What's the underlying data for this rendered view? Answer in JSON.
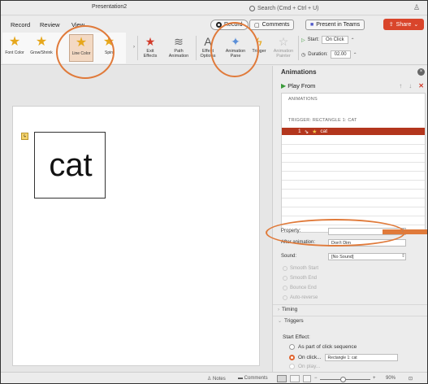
{
  "window": {
    "title": "Presentation2"
  },
  "search": {
    "placeholder": "Search (Cmd + Ctrl + U)"
  },
  "ribbon_tabs": [
    "Record",
    "Review",
    "View"
  ],
  "toolbar": {
    "record_label": "Record",
    "comments_label": "Comments",
    "teams_label": "Present in Teams",
    "share_label": "Share"
  },
  "gallery": {
    "items": [
      "Font Color",
      "Grow/Shrink",
      "Line Color",
      "Spin"
    ],
    "selected": "Line Color"
  },
  "ribbon_buttons": {
    "exit_effects": [
      "Exit",
      "Effects"
    ],
    "path_animation": [
      "Path",
      "Animation"
    ],
    "effect_options": [
      "Effect",
      "Options"
    ],
    "animation_pane": [
      "Animation",
      "Pane"
    ],
    "trigger": "Trigger",
    "animation_painter": [
      "Animation",
      "Painter"
    ]
  },
  "timing": {
    "start_label": "Start:",
    "start_value": "On Click",
    "duration_label": "Duration:",
    "duration_value": "02.00"
  },
  "slide": {
    "shape_text": "cat"
  },
  "pane": {
    "title": "Animations",
    "play_label": "Play From",
    "list_header": "ANIMATIONS",
    "trigger_header": "TRIGGER: RECTANGLE 1: CAT",
    "selected_item": {
      "number": "1",
      "name": "cat"
    },
    "property_label": "Property:",
    "property_color": "#e07a3a",
    "after_label": "After animation:",
    "after_value": "Don't Dim",
    "sound_label": "Sound:",
    "sound_value": "[No Sound]",
    "options": [
      "Smooth Start",
      "Smooth End",
      "Bounce End",
      "Auto-reverse"
    ],
    "timing_section": "Timing",
    "triggers_section": "Triggers",
    "start_effect_label": "Start Effect:",
    "radio_sequence": "As part of click sequence",
    "radio_onclick": "On click...",
    "onclick_value": "Rectangle 1: cat",
    "radio_onplay": "On play..."
  },
  "statusbar": {
    "notes": "Notes",
    "comments": "Comments",
    "zoom": "90%"
  },
  "colors": {
    "accent": "#e07a3a",
    "selection": "#b3361d",
    "share": "#d9452b"
  }
}
